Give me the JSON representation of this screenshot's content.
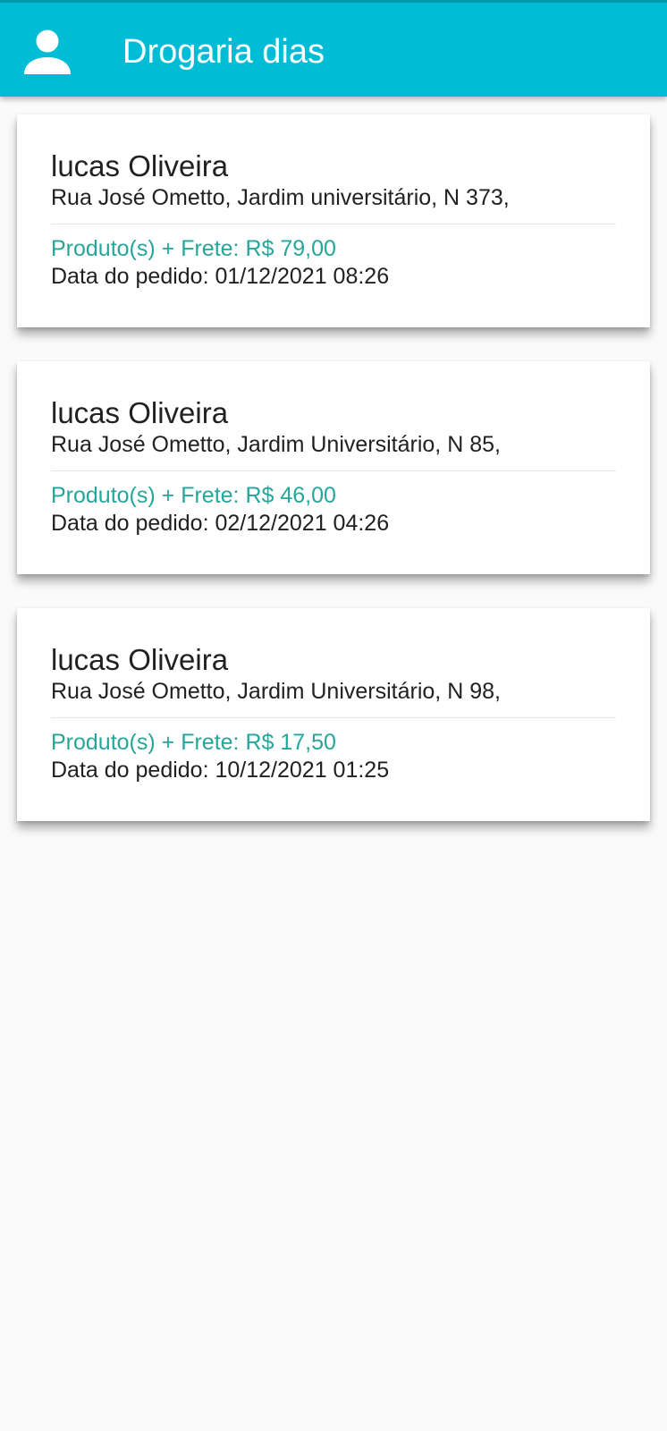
{
  "app_bar": {
    "title": "Drogaria dias",
    "profile_icon": "person-icon",
    "background_color": "#00bcd4"
  },
  "orders": [
    {
      "customer": "lucas Oliveira",
      "address": "Rua José Ometto, Jardim universitário, N 373,",
      "total": "Produto(s) + Frete: R$ 79,00",
      "date": "Data do pedido: 01/12/2021 08:26"
    },
    {
      "customer": "lucas Oliveira",
      "address": "Rua José Ometto, Jardim Universitário, N 85,",
      "total": "Produto(s) + Frete: R$ 46,00",
      "date": "Data do pedido: 02/12/2021 04:26"
    },
    {
      "customer": "lucas Oliveira",
      "address": "Rua José Ometto, Jardim Universitário, N 98,",
      "total": "Produto(s) + Frete: R$ 17,50",
      "date": "Data do pedido: 10/12/2021 01:25"
    }
  ],
  "colors": {
    "accent": "#26a69a",
    "text": "#212121"
  }
}
